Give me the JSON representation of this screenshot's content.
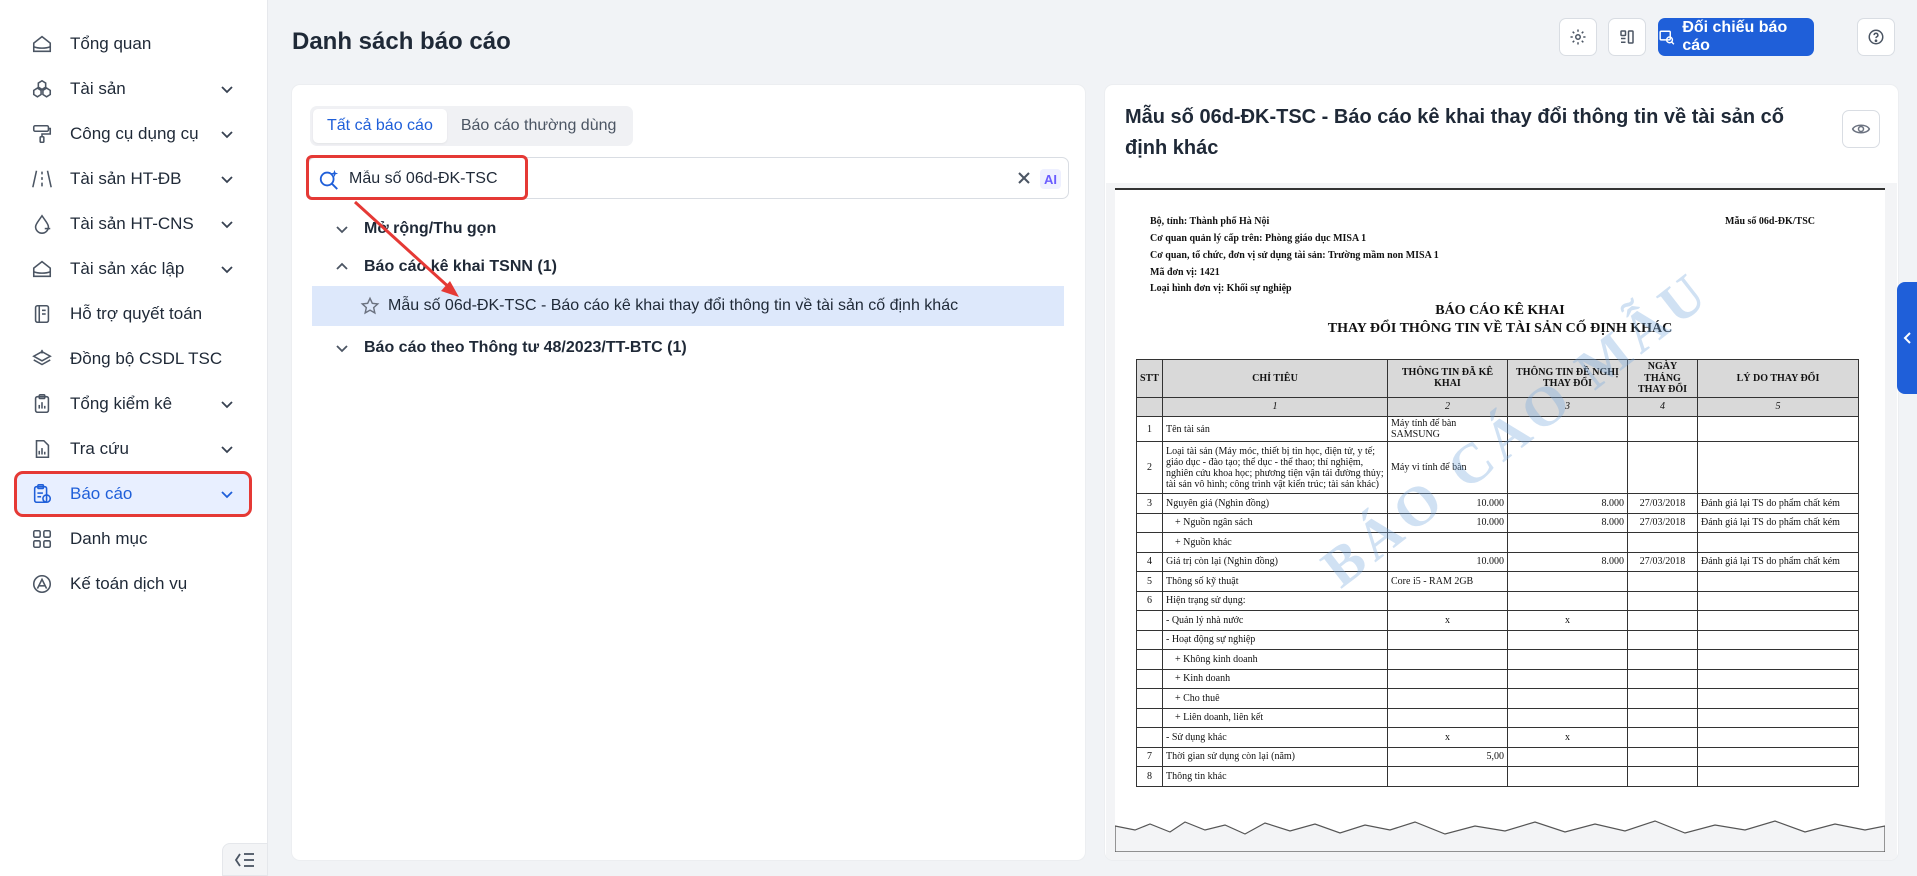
{
  "sidebar": {
    "items": [
      {
        "label": "Tổng quan",
        "icon": "home-icon",
        "chevron": false
      },
      {
        "label": "Tài sản",
        "icon": "cubes-icon",
        "chevron": true
      },
      {
        "label": "Công cụ dụng cụ",
        "icon": "paint-roller-icon",
        "chevron": true
      },
      {
        "label": "Tài sản HT-ĐB",
        "icon": "road-icon",
        "chevron": true
      },
      {
        "label": "Tài sản HT-CNS",
        "icon": "water-drop-icon",
        "chevron": true
      },
      {
        "label": "Tài sản xác lập",
        "icon": "home-outline-icon",
        "chevron": true
      },
      {
        "label": "Hỗ trợ quyết toán",
        "icon": "ledger-icon",
        "chevron": false
      },
      {
        "label": "Đồng bộ CSDL TSC",
        "icon": "layers-sync-icon",
        "chevron": false
      },
      {
        "label": "Tổng kiểm kê",
        "icon": "clipboard-chart-icon",
        "chevron": true
      },
      {
        "label": "Tra cứu",
        "icon": "document-chart-icon",
        "chevron": true
      },
      {
        "label": "Báo cáo",
        "icon": "report-clipboard-icon",
        "chevron": true,
        "active": true
      },
      {
        "label": "Danh mục",
        "icon": "grid-icon",
        "chevron": false
      },
      {
        "label": "Kế toán dịch vụ",
        "icon": "accounting-service-icon",
        "chevron": false
      }
    ]
  },
  "header": {
    "title": "Danh sách báo cáo",
    "primary_button": "Đối chiếu báo cáo"
  },
  "left_panel": {
    "tabs": [
      "Tất cả báo cáo",
      "Báo cáo thường dùng"
    ],
    "search": {
      "value": "Mẫu số 06d-ĐK-TSC",
      "ai_label": "AI"
    },
    "tree": {
      "expand_collapse": "Mở rộng/Thu gọn",
      "group1": "Báo cáo kê khai TSNN (1)",
      "leaf1": "Mẫu số 06d-ĐK-TSC - Báo cáo kê khai thay đổi thông tin về tài sản cố định khác",
      "group2": "Báo cáo theo Thông tư 48/2023/TT-BTC (1)"
    }
  },
  "preview": {
    "title": "Mẫu số 06d-ĐK-TSC - Báo cáo kê khai thay đổi thông tin về tài sản cố định khác",
    "doc": {
      "header_lines": [
        "Bộ, tỉnh: Thành phố Hà Nội",
        "Cơ quan quản lý cấp trên: Phòng giáo dục MISA 1",
        "Cơ quan, tổ chức, đơn vị sử dụng tài sản: Trường mầm non MISA 1",
        "Mã đơn vị: 1421",
        "Loại hình đơn vị: Khối sự nghiệp"
      ],
      "form_code": "Mẫu số 06d-ĐK/TSC",
      "title1": "BÁO CÁO KÊ KHAI",
      "title2": "THAY ĐỔI THÔNG TIN VỀ TÀI SẢN CỐ ĐỊNH KHÁC",
      "columns": [
        "STT",
        "CHỈ TIÊU",
        "THÔNG TIN ĐÃ KÊ KHAI",
        "THÔNG TIN ĐỀ NGHỊ THAY ĐỔI",
        "NGÀY THÁNG THAY ĐỔI",
        "LÝ DO THAY ĐỔI"
      ],
      "col_numbers": [
        "",
        "1",
        "2",
        "3",
        "4",
        "5"
      ],
      "rows": [
        [
          "1",
          "Tên tài sản",
          "Máy tính để bàn SAMSUNG",
          "",
          "",
          ""
        ],
        [
          "2",
          "Loại tài sản (Máy móc, thiết bị tin học, điện tử, y tế; giáo dục - đào tạo; thể dục - thể thao; thí nghiệm, nghiên cứu khoa học; phương tiện vận tải đường thủy; tài sản vô hình; công trình vật kiến trúc; tài sản khác)",
          "Máy vi tính để bàn",
          "",
          "",
          ""
        ],
        [
          "3",
          "Nguyên giá (Nghìn đồng)",
          "10.000",
          "8.000",
          "27/03/2018",
          "Đánh giá lại TS do phẩm chất kém"
        ],
        [
          "",
          "   + Nguồn ngân sách",
          "10.000",
          "8.000",
          "27/03/2018",
          "Đánh giá lại TS do phẩm chất kém"
        ],
        [
          "",
          "   + Nguồn khác",
          "",
          "",
          "",
          ""
        ],
        [
          "4",
          "Giá trị còn lại (Nghìn đồng)",
          "10.000",
          "8.000",
          "27/03/2018",
          "Đánh giá lại TS do phẩm chất kém"
        ],
        [
          "5",
          "Thông số kỹ thuật",
          "Core i5 - RAM 2GB",
          "",
          "",
          ""
        ],
        [
          "6",
          "Hiện trạng sử dụng:",
          "",
          "",
          "",
          ""
        ],
        [
          "",
          "- Quản lý nhà nước",
          "x",
          "x",
          "",
          ""
        ],
        [
          "",
          "- Hoạt động sự nghiệp",
          "",
          "",
          "",
          ""
        ],
        [
          "",
          "   + Không kinh doanh",
          "",
          "",
          "",
          ""
        ],
        [
          "",
          "   + Kinh doanh",
          "",
          "",
          "",
          ""
        ],
        [
          "",
          "   + Cho thuê",
          "",
          "",
          "",
          ""
        ],
        [
          "",
          "   + Liên doanh, liên kết",
          "",
          "",
          "",
          ""
        ],
        [
          "",
          "- Sử dụng khác",
          "x",
          "x",
          "",
          ""
        ],
        [
          "7",
          "Thời gian sử dụng còn lại (năm)",
          "5,00",
          "",
          "",
          ""
        ],
        [
          "8",
          "Thông tin khác",
          "",
          "",
          "",
          ""
        ]
      ],
      "watermark": "BÁO CÁO MẪU"
    }
  },
  "colors": {
    "accent": "#1f5fd9",
    "highlight": "#e53935",
    "selected_row": "#dde8fb"
  }
}
